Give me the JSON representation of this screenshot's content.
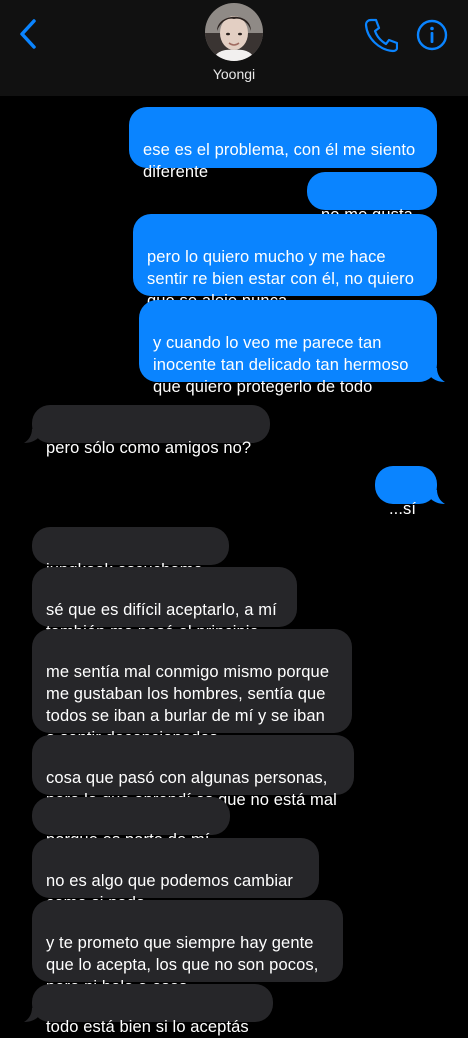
{
  "header": {
    "contact_name": "Yoongi",
    "back_icon": "chevron-left-icon",
    "phone_icon": "phone-icon",
    "info_icon": "info-icon",
    "accent_color": "#0a84ff"
  },
  "colors": {
    "sent_bubble": "#0a84ff",
    "received_bubble": "#262629",
    "background": "#000000",
    "header_background": "#111111"
  },
  "messages": [
    {
      "direction": "sent",
      "text": "ese es el problema, con él me siento\ndiferente"
    },
    {
      "direction": "sent",
      "text": "no me gusta"
    },
    {
      "direction": "sent",
      "text": "pero lo quiero mucho y me hace\nsentir re bien estar con él, no quiero\nque se aleje nunca"
    },
    {
      "direction": "sent",
      "text": "y cuando lo veo me parece tan\ninocente tan delicado tan hermoso\nque quiero protegerlo de todo"
    },
    {
      "direction": "received",
      "text": "pero sólo como amigos no?"
    },
    {
      "direction": "sent",
      "text": "...sí"
    },
    {
      "direction": "received",
      "text": "jungkook escuchame"
    },
    {
      "direction": "received",
      "text": "sé que es difícil aceptarlo, a mí\ntambién me pasó al principio"
    },
    {
      "direction": "received",
      "text": "me sentía mal conmigo mismo porque\nme gustaban los hombres, sentía que\ntodos se iban a burlar de mí y se iban\na sentir decepcionados"
    },
    {
      "direction": "received",
      "text": "cosa que pasó con algunas personas,\npero lo que aprendí es que no está mal"
    },
    {
      "direction": "received",
      "text": "porque es parte de mí"
    },
    {
      "direction": "received",
      "text": "no es algo que podemos cambiar\ncomo si nada"
    },
    {
      "direction": "received",
      "text": "y te prometo que siempre hay gente\nque lo acepta, los que no son pocos,\npero ni bola a esos"
    },
    {
      "direction": "received",
      "text": "todo está bien si lo aceptás"
    }
  ]
}
